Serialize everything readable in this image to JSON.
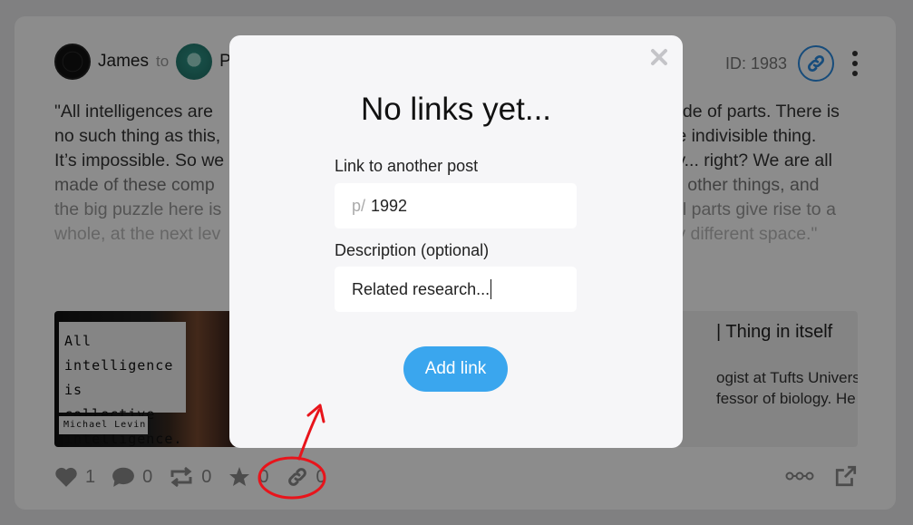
{
  "post": {
    "author": "James",
    "to_label": "to",
    "recipient_partial": "Po",
    "id_label": "ID: 1983",
    "body_lines": [
      "\"All intelligences are made of parts. There is",
      "no such thing as this, le indivisible thing.",
      "It’s impossible. So we ly... right? We are all",
      "made of these comp d other things, and",
      "the big puzzle here is al parts give rise to a",
      "whole, at the next lev ly different space.\""
    ],
    "body_left": [
      "\"All intelligences are",
      "no such thing as this,",
      "It’s impossible. So we",
      "made of these comp",
      "the big puzzle here is",
      "whole, at the next lev"
    ],
    "body_right": [
      "ade of parts. There is",
      "le indivisible thing.",
      "ly... right? We are all",
      "d other things, and",
      "al parts give rise to a",
      "ly different space.\""
    ],
    "preview": {
      "quote_lines": [
        "All intelligence",
        "is collective",
        "intelligence."
      ],
      "quote_author": "Michael Levin",
      "title": "| Thing in itself",
      "desc_lines": [
        "ogist at Tufts Universi",
        "fessor of biology. He"
      ]
    },
    "actions": {
      "likes": "1",
      "comments": "0",
      "reposts": "0",
      "stars": "0",
      "links": "0"
    }
  },
  "modal": {
    "title": "No links yet...",
    "close_icon": "close-icon",
    "link_label": "Link to another post",
    "link_prefix": "p/",
    "link_value": "1992",
    "desc_label": "Description (optional)",
    "desc_value": "Related research...",
    "add_button": "Add link"
  },
  "colors": {
    "accent": "#3aa6ee",
    "link_icon": "#2a8ae0",
    "annotation": "#e8141b"
  }
}
